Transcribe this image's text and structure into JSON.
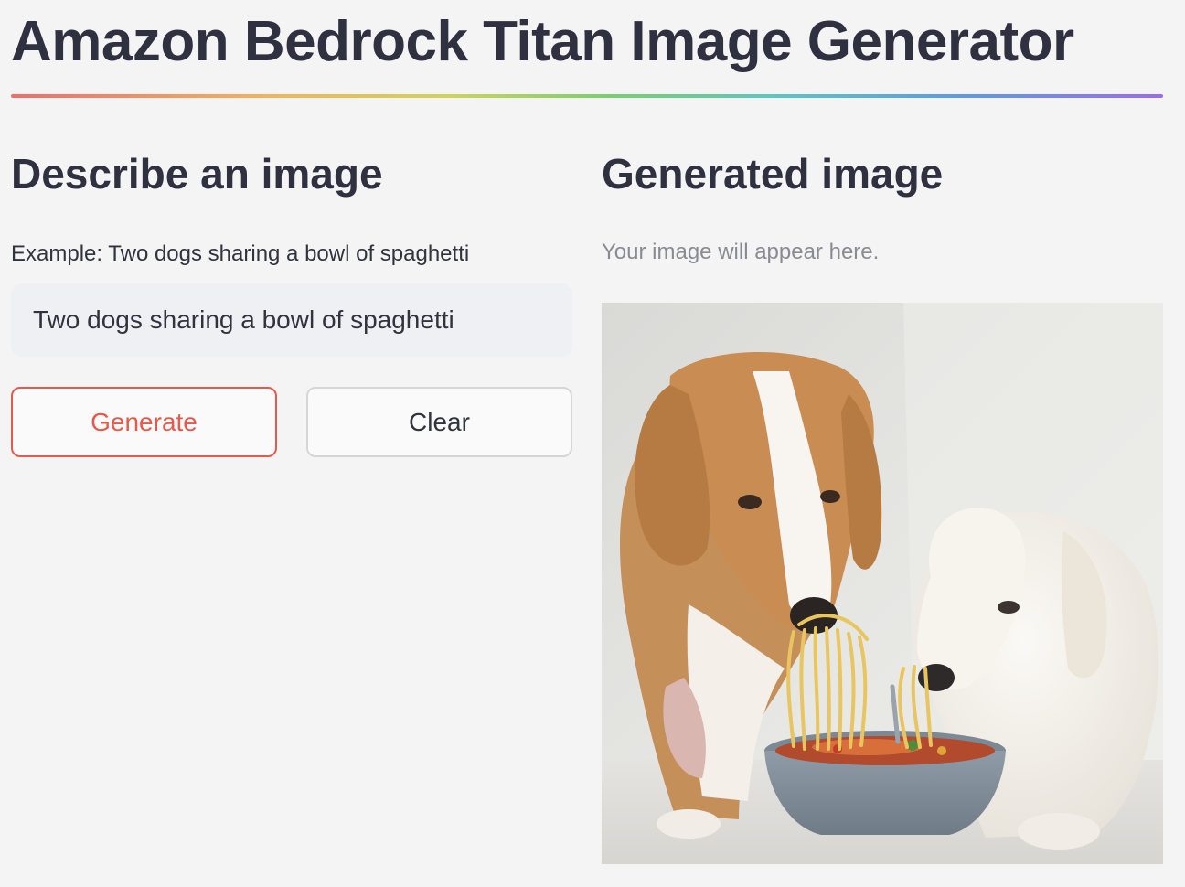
{
  "header": {
    "title": "Amazon Bedrock Titan Image Generator"
  },
  "describe_panel": {
    "heading": "Describe an image",
    "prompt_label": "Example: Two dogs sharing a bowl of spaghetti",
    "prompt_value": "Two dogs sharing a bowl of spaghetti",
    "generate_label": "Generate",
    "clear_label": "Clear"
  },
  "output_panel": {
    "heading": "Generated image",
    "placeholder": "Your image will appear here."
  },
  "colors": {
    "accent": "#e55a4a",
    "background": "#f4f4f4",
    "text": "#2f3140"
  }
}
